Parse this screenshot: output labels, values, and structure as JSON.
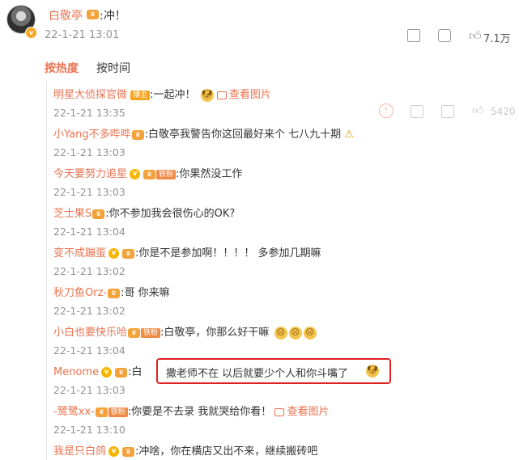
{
  "post": {
    "author": "白敬亭",
    "text": ":冲！",
    "time": "22-1-21 13:01",
    "like_count": "7.1万"
  },
  "tabs": [
    "按热度",
    "按时间"
  ],
  "first_actions": {
    "like_count": "5420"
  },
  "comments": [
    {
      "name": "明星大侦探官微",
      "badge": "博主",
      "text": ":一起冲！",
      "emoji": "doge",
      "view_image": "查看图片",
      "time": "22-1-21 13:35"
    },
    {
      "name": "小Yang不多哔哔",
      "text": ":白敬亭我警告你这回最好来个 七八九十期",
      "emoji": "warning",
      "time": "22-1-21 13:03"
    },
    {
      "name": "今天要努力追星",
      "fan_label": "铁粉",
      "text": ":你果然没工作",
      "time": "22-1-21 13:03"
    },
    {
      "name": "芝士果S",
      "text": ":你不参加我会很伤心的OK?",
      "time": "22-1-21 13:04"
    },
    {
      "name": "变不成蹦蛋",
      "text": ":你是不是参加啊！！！！ 多参加几期嘛",
      "time": "22-1-21 13:02"
    },
    {
      "name": "秋刀鱼Orz-",
      "text": ":哥 你来嘛",
      "time": "22-1-21 13:02"
    },
    {
      "name": "小白也要快乐哈",
      "fan_label": "铁粉",
      "text": ":白敬亭，你那么好干嘛",
      "time": "22-1-21 13:04"
    },
    {
      "name": "Menome",
      "text": ":白",
      "highlight": "撒老师不在 以后就要少个人和你斗嘴了",
      "time": "22-1-21 13:03"
    },
    {
      "name": "-鹭鹭xx-",
      "fan_label": "铁粉",
      "text": ":你要是不去录 我就哭给你看！",
      "view_image": "查看图片",
      "time": "22-1-21 13:10"
    },
    {
      "name": "我是只白鸽",
      "text": ":冲啥，你在横店又出不来，继续搬砖吧"
    }
  ],
  "colors": {
    "accent": "#eb7350",
    "muted": "#939393",
    "highlight_border": "#e02020"
  }
}
